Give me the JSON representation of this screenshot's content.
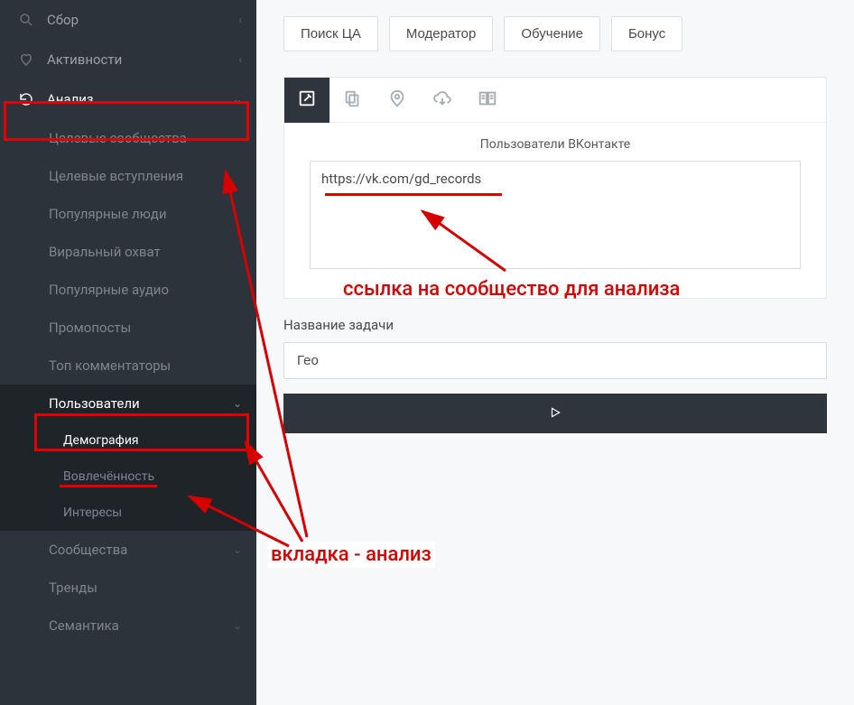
{
  "sidebar": {
    "items": {
      "sbor": "Сбор",
      "activities": "Активности",
      "analysis": "Анализ"
    },
    "analysis_children": {
      "target_communities": "Целевые сообщества",
      "target_joins": "Целевые вступления",
      "popular_people": "Популярные люди",
      "viral_reach": "Виральный охват",
      "popular_audio": "Популярные аудио",
      "promoposts": "Промопосты",
      "top_commenters": "Топ комментаторы",
      "users": "Пользователи",
      "users_children": {
        "demography": "Демография",
        "engagement": "Вовлечённость",
        "interests": "Интересы"
      },
      "communities": "Сообщества",
      "trends": "Тренды",
      "semantics": "Семантика"
    }
  },
  "topnav": {
    "search_ca": "Поиск ЦА",
    "moderator": "Модератор",
    "training": "Обучение",
    "bonus": "Бонус"
  },
  "panel": {
    "title": "Пользователи ВКонтакте",
    "url_value": "https://vk.com/gd_records",
    "task_label": "Название задачи",
    "task_value": "Гео"
  },
  "annotations": {
    "link_label": "ссылка на сообщество для анализа",
    "tab_label": "вкладка - анализ"
  }
}
